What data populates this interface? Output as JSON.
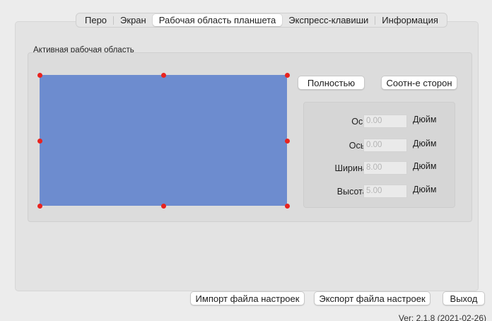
{
  "tabs": [
    {
      "label": "Перо",
      "active": false
    },
    {
      "label": "Экран",
      "active": false
    },
    {
      "label": "Рабочая область планшета",
      "active": true
    },
    {
      "label": "Экспресс-клавиши",
      "active": false
    },
    {
      "label": "Информация",
      "active": false
    }
  ],
  "active_area": {
    "title": "Активная рабочая область",
    "area_color": "#6d8ccf",
    "handle_color": "#e8231f",
    "full_button": "Полностью",
    "aspect_button": "Соотн-е сторон"
  },
  "fields": [
    {
      "label": "Ось[X]",
      "value": "0.00",
      "unit": "Дюйм"
    },
    {
      "label": "Ось [Y]",
      "value": "0.00",
      "unit": "Дюйм"
    },
    {
      "label": "Ширина[X]",
      "value": "8.00",
      "unit": "Дюйм"
    },
    {
      "label": "Высота[Y]",
      "value": "5.00",
      "unit": "Дюйм"
    }
  ],
  "footer": {
    "import_button": "Импорт файла настроек",
    "export_button": "Экспорт файла настроек",
    "exit_button": "Выход",
    "version": "Ver: 2.1.8 (2021-02-26)"
  }
}
